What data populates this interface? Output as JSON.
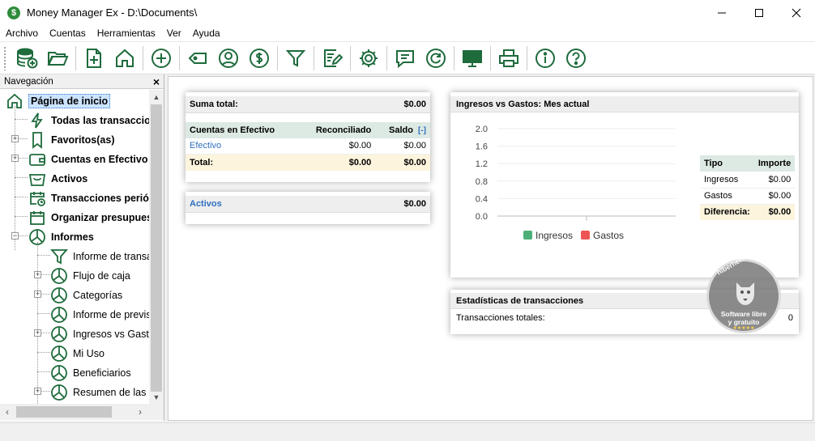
{
  "window": {
    "title": "Money Manager Ex - D:\\Documents\\",
    "app_icon": "$"
  },
  "menu": [
    "Archivo",
    "Cuentas",
    "Herramientas",
    "Ver",
    "Ayuda"
  ],
  "colors": {
    "accent": "#1e6b3c",
    "header_bg": "#dde9e3",
    "total_bg": "#fcf4dc",
    "link": "#2f6fc0",
    "ingresos": "#4caf78",
    "gastos": "#ee5555"
  },
  "navigation": {
    "title": "Navegación",
    "items": [
      {
        "label": "Página de inicio",
        "icon": "home-icon"
      },
      {
        "label": "Todas las transacciones",
        "icon": "lightning-icon"
      },
      {
        "label": "Favoritos(as)",
        "icon": "bookmark-icon"
      },
      {
        "label": "Cuentas en Efectivo",
        "icon": "wallet-icon"
      },
      {
        "label": "Activos",
        "icon": "basket-icon"
      },
      {
        "label": "Transacciones periódicas",
        "icon": "calendar-clock-icon"
      },
      {
        "label": "Organizar presupuesto",
        "icon": "calendar-icon"
      },
      {
        "label": "Informes",
        "icon": "pie-chart-icon"
      },
      {
        "label": "Informe de transacciones",
        "icon": "filter-icon"
      },
      {
        "label": "Flujo de caja",
        "icon": "pie-chart-icon"
      },
      {
        "label": "Categorías",
        "icon": "pie-chart-icon"
      },
      {
        "label": "Informe de previsión",
        "icon": "pie-chart-icon"
      },
      {
        "label": "Ingresos vs Gastos",
        "icon": "pie-chart-icon"
      },
      {
        "label": "Mi Uso",
        "icon": "pie-chart-icon"
      },
      {
        "label": "Beneficiarios",
        "icon": "pie-chart-icon"
      },
      {
        "label": "Resumen de las cuentas",
        "icon": "pie-chart-icon"
      }
    ]
  },
  "summary": {
    "total_label": "Suma total:",
    "total_value": "$0.00",
    "columns": [
      "Cuentas en Efectivo",
      "Reconciliado",
      "Saldo",
      "[-]"
    ],
    "row": {
      "name": "Efectivo",
      "reconciled": "$0.00",
      "balance": "$0.00"
    },
    "footer": {
      "label": "Total:",
      "reconciled": "$0.00",
      "balance": "$0.00"
    }
  },
  "assets": {
    "label": "Activos",
    "value": "$0.00"
  },
  "income_expense": {
    "title": "Ingresos vs Gastos: Mes actual",
    "table": {
      "headers": [
        "Tipo",
        "Importe"
      ],
      "rows": [
        {
          "type": "Ingresos",
          "amount": "$0.00"
        },
        {
          "type": "Gastos",
          "amount": "$0.00"
        }
      ],
      "diff_label": "Diferencia:",
      "diff_value": "$0.00"
    }
  },
  "chart_data": {
    "type": "bar",
    "categories": [
      ""
    ],
    "series": [
      {
        "name": "Ingresos",
        "values": [
          0
        ]
      },
      {
        "name": "Gastos",
        "values": [
          0
        ]
      }
    ],
    "yticks": [
      "2.0",
      "1.6",
      "1.2",
      "0.8",
      "0.4",
      "0.0"
    ],
    "ylim": [
      0,
      2.0
    ],
    "legend": "bottom",
    "grid": true
  },
  "stats": {
    "title": "Estadísticas de transacciones",
    "label": "Transacciones totales:",
    "value": "0"
  },
  "watermark": {
    "site": "hiberhernandez.com",
    "line1": "Software libre",
    "line2": "y gratuito",
    "stars": "★★★★★"
  }
}
